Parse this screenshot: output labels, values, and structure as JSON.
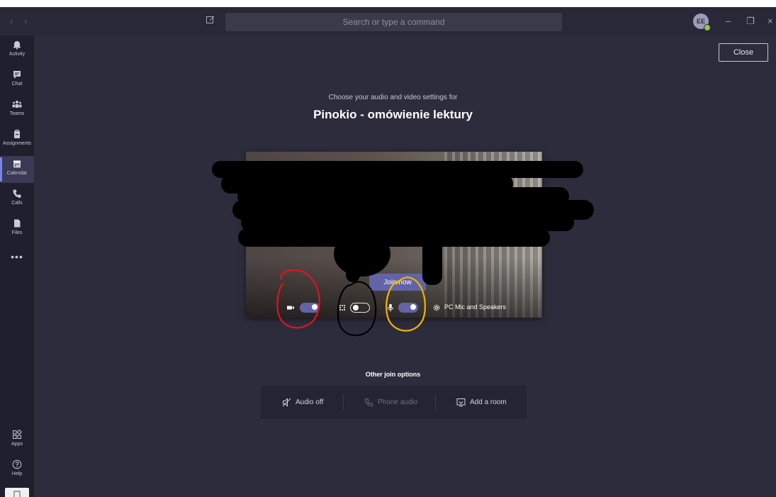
{
  "titlebar": {
    "back_glyph": "‹",
    "forward_glyph": "›",
    "search_placeholder": "Search or type a command",
    "avatar_initials": "EE",
    "minimize_glyph": "–",
    "maximize_glyph": "❐",
    "close_glyph": "×"
  },
  "rail": {
    "items": [
      {
        "label": "Activity",
        "icon": "bell-icon"
      },
      {
        "label": "Chat",
        "icon": "chat-icon"
      },
      {
        "label": "Teams",
        "icon": "teams-icon"
      },
      {
        "label": "Assignments",
        "icon": "assignments-icon"
      },
      {
        "label": "Calendar",
        "icon": "calendar-icon",
        "active": true
      },
      {
        "label": "Calls",
        "icon": "phone-icon"
      },
      {
        "label": "Files",
        "icon": "file-icon"
      }
    ],
    "more_glyph": "•••",
    "bottom": [
      {
        "label": "Apps",
        "icon": "apps-icon"
      },
      {
        "label": "Help",
        "icon": "help-icon"
      }
    ]
  },
  "main": {
    "close_label": "Close",
    "subtitle": "Choose your audio and video settings for",
    "meeting_title": "Pinokio - omówienie lektury",
    "join_label": "Join now",
    "controls": {
      "camera_on": true,
      "background_blur_on": false,
      "mic_on": true,
      "device_label": "PC Mic and Speakers"
    },
    "other_options_label": "Other join options",
    "options": {
      "audio_off": "Audio off",
      "phone_audio": "Phone audio",
      "add_room": "Add a room"
    }
  },
  "colors": {
    "background": "#2d2c3c",
    "rail": "#201f2d",
    "accent": "#6264a7",
    "annotation_red": "#e0141e",
    "annotation_black": "#000000",
    "annotation_yellow": "#f2b400"
  }
}
